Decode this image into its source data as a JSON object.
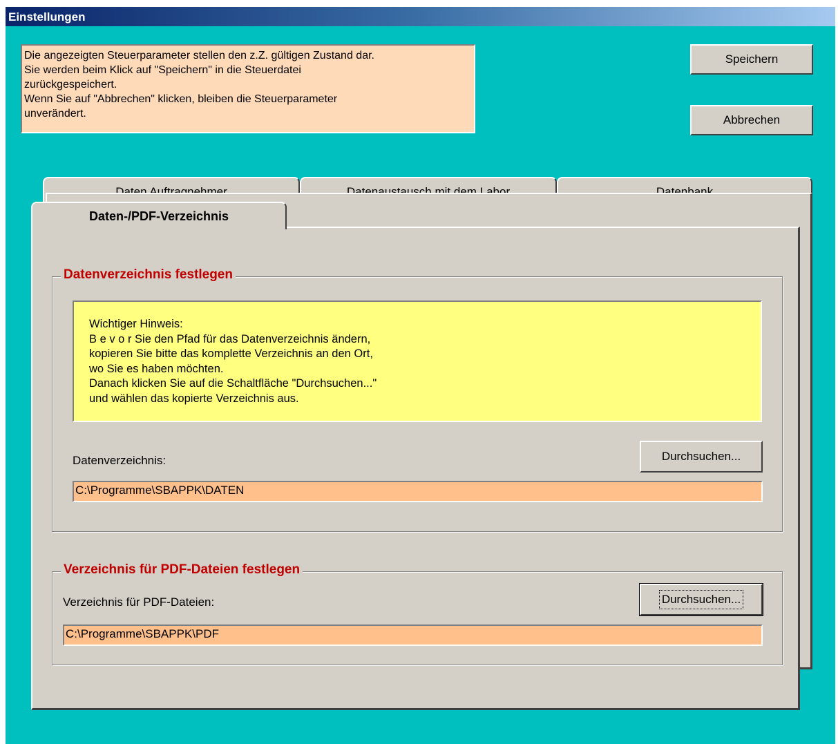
{
  "window": {
    "title": "Einstellungen"
  },
  "info": {
    "text": "Die angezeigten Steuerparameter stellen den z.Z. gültigen Zustand dar.\nSie werden beim Klick auf \"Speichern\" in die Steuerdatei\nzurückgespeichert.\nWenn Sie auf \"Abbrechen\" klicken, bleiben die Steuerparameter\nunverändert."
  },
  "buttons": {
    "save": "Speichern",
    "cancel": "Abbrechen"
  },
  "tabs": [
    {
      "label": "Daten Auftragnehmer"
    },
    {
      "label": "Datenaustausch mit dem Labor"
    },
    {
      "label": "Datenbank"
    },
    {
      "label": "Daten-/PDF-Verzeichnis",
      "active": true
    }
  ],
  "data_dir": {
    "legend": "Datenverzeichnis festlegen",
    "hint": "Wichtiger Hinweis:\nB e v o r  Sie den Pfad für das Datenverzeichnis ändern,\nkopieren Sie bitte das komplette Verzeichnis an den Ort,\nwo Sie es haben möchten.\nDanach klicken Sie auf die Schaltfläche \"Durchsuchen...\"\nund wählen das kopierte Verzeichnis aus.",
    "label": "Datenverzeichnis:",
    "browse": "Durchsuchen...",
    "path": "C:\\Programme\\SBAPPK\\DATEN"
  },
  "pdf_dir": {
    "legend": "Verzeichnis für PDF-Dateien festlegen",
    "label": "Verzeichnis für PDF-Dateien:",
    "browse": "Durchsuchen...",
    "path": "C:\\Programme\\SBAPPK\\PDF"
  },
  "colors": {
    "background": "#00bfbf",
    "info_box": "#ffdab9",
    "hint_box": "#ffff80",
    "path_field": "#ffc08c",
    "legend_text": "#c00000",
    "panel": "#d4d0c8"
  }
}
